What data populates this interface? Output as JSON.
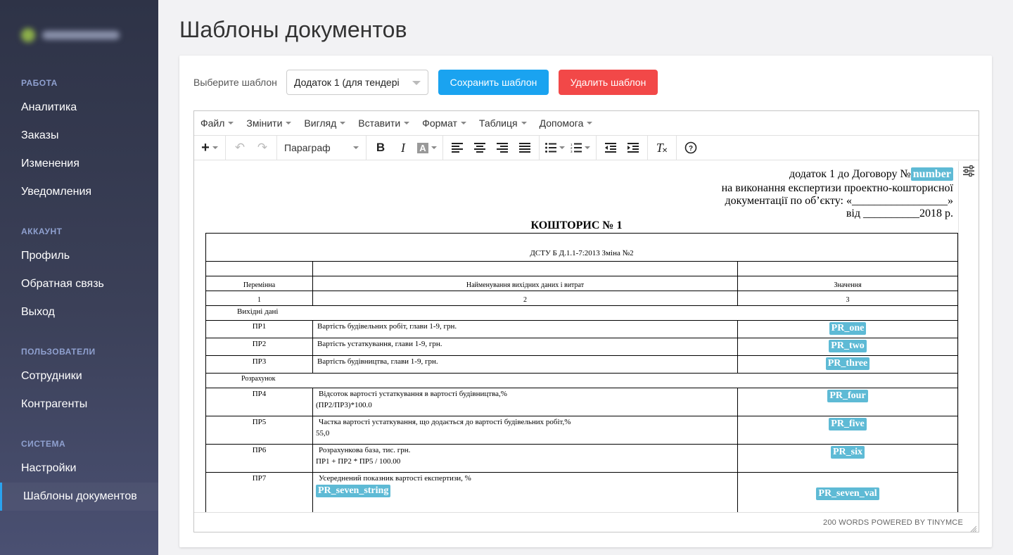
{
  "sidebar": {
    "sections": [
      {
        "title": "РАБОТА",
        "items": [
          "Аналитика",
          "Заказы",
          "Изменения",
          "Уведомления"
        ]
      },
      {
        "title": "АККАУНТ",
        "items": [
          "Профиль",
          "Обратная связь",
          "Выход"
        ]
      },
      {
        "title": "ПОЛЬЗОВАТЕЛИ",
        "items": [
          "Сотрудники",
          "Контрагенты"
        ]
      },
      {
        "title": "СИСТЕМА",
        "items": [
          "Настройки",
          "Шаблоны документов"
        ]
      }
    ]
  },
  "page": {
    "title": "Шаблоны документов"
  },
  "controls": {
    "select_label": "Выберите шаблон",
    "select_value": "Додаток 1 (для тендері",
    "save_label": "Сохранить шаблон",
    "delete_label": "Удалить шаблон"
  },
  "editor": {
    "menu": [
      "Файл",
      "Змінити",
      "Вигляд",
      "Вставити",
      "Формат",
      "Таблиця",
      "Допомога"
    ],
    "format_select": "Параграф",
    "status": "200 WORDS POWERED BY TINYMCE"
  },
  "document": {
    "header_line1": "додаток 1 до Договору №",
    "header_tag": "number",
    "header_line2": "на виконання експертизи проектно-кошторисної",
    "header_line3": "документації по об’єкту: «_________________»",
    "header_line4": "від __________2018 р.",
    "title": "КОШТОРИС № 1",
    "standard": "ДСТУ Б Д.1.1-7:2013 Зміна №2",
    "col_headers": [
      "Перемінна",
      "Найменування вихідних даних і витрат",
      "Значення"
    ],
    "col_numbers": [
      "1",
      "2",
      "3"
    ],
    "section_input": "Вихідні дані",
    "section_calc": "Розрахунок",
    "rows_input": [
      {
        "var": "ПР1",
        "name": "Вартість будівельних робіт, глави 1-9, грн.",
        "value": "PR_one"
      },
      {
        "var": "ПР2",
        "name": "Вартість устаткування, глави 1-9, грн.",
        "value": "PR_two"
      },
      {
        "var": "ПР3",
        "name": "Вартість будівництва, глави 1-9, грн.",
        "value": "PR_three"
      }
    ],
    "rows_calc": [
      {
        "var": "ПР4",
        "name": "Відсоток вартості устаткування в вартості будівництва,%",
        "formula": "(ПР2/ПР3)*100.0",
        "value": "PR_four"
      },
      {
        "var": "ПР5",
        "name": "Частка вартості устаткування, що додається до вартості будівельних робіт,%",
        "formula": "55,0",
        "value": "PR_five"
      },
      {
        "var": "ПР6",
        "name": "Розрахункова база, тис. грн.",
        "formula": "ПР1 + ПР2 * ПР5 / 100.00",
        "value": "PR_six"
      },
      {
        "var": "ПР7",
        "name": "Усереднений показник вартості експертизи, %",
        "formula_tag": "PR_seven_string",
        "value": "PR_seven_val"
      }
    ]
  }
}
